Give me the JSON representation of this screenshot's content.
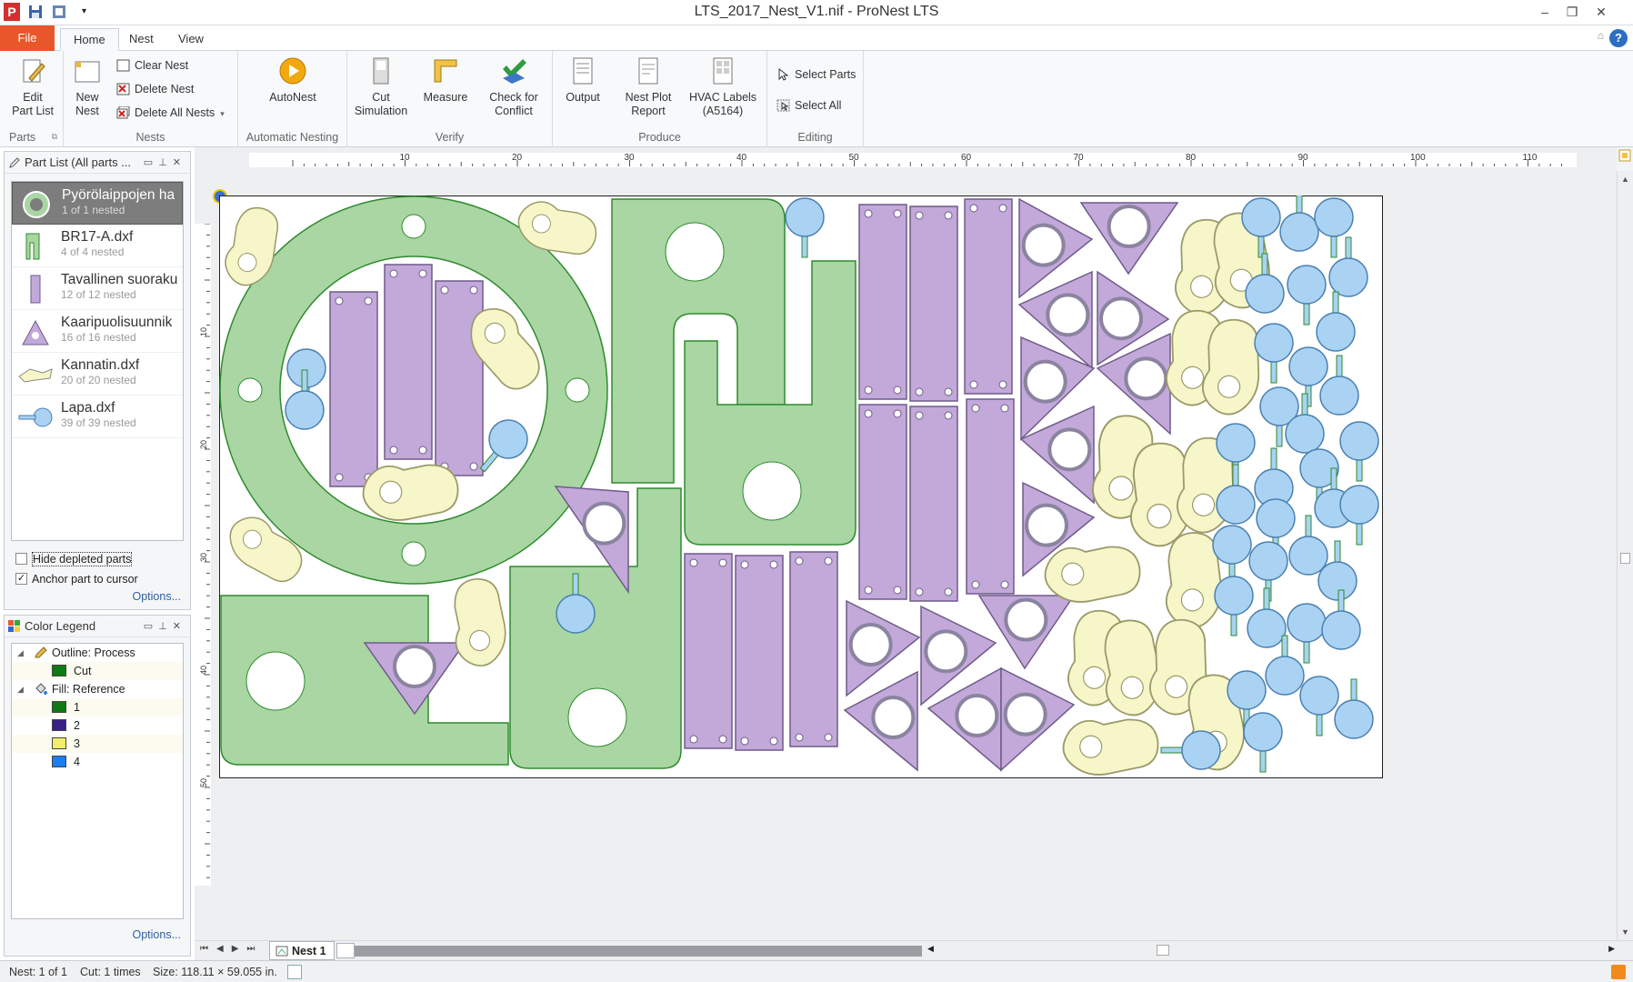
{
  "window": {
    "title": "LTS_2017_Nest_V1.nif - ProNest LTS",
    "logo_letter": "P"
  },
  "tabs": {
    "file": "File",
    "home": "Home",
    "nest": "Nest",
    "view": "View"
  },
  "help_glyph": "?",
  "ribbon": {
    "parts": {
      "edit_l1": "Edit",
      "edit_l2": "Part List",
      "label": "Parts"
    },
    "nests": {
      "new_l1": "New",
      "new_l2": "Nest",
      "clear": "Clear Nest",
      "delete": "Delete Nest",
      "delete_all": "Delete All Nests",
      "label": "Nests"
    },
    "automatic": {
      "autonest": "AutoNest",
      "label": "Automatic Nesting"
    },
    "verify": {
      "cut_l1": "Cut",
      "cut_l2": "Simulation",
      "measure": "Measure",
      "check_l1": "Check for",
      "check_l2": "Conflict",
      "label": "Verify"
    },
    "produce": {
      "output": "Output",
      "report_l1": "Nest Plot",
      "report_l2": "Report",
      "hvac_l1": "HVAC Labels",
      "hvac_l2": "(A5164)",
      "label": "Produce"
    },
    "editing": {
      "select_parts": "Select Parts",
      "select_all": "Select All",
      "label": "Editing"
    }
  },
  "part_list": {
    "title": "Part List  (All parts ...",
    "items": [
      {
        "name": "Pyörölaippojen ha",
        "count": "1 of 1 nested",
        "shape": "ring"
      },
      {
        "name": "BR17-A.dxf",
        "count": "4 of 4 nested",
        "shape": "bracket"
      },
      {
        "name": "Tavallinen suoraku",
        "count": "12 of 12 nested",
        "shape": "rect"
      },
      {
        "name": "Kaaripuolisuunnik",
        "count": "16 of 16 nested",
        "shape": "tri"
      },
      {
        "name": "Kannatin.dxf",
        "count": "20 of 20 nested",
        "shape": "hook"
      },
      {
        "name": "Lapa.dxf",
        "count": "39 of 39 nested",
        "shape": "paddle"
      }
    ],
    "hide_depleted": "Hide depleted parts",
    "anchor_cursor": "Anchor part to cursor",
    "options": "Options..."
  },
  "color_legend": {
    "title": "Color Legend",
    "outline": "Outline: Process",
    "cut": "Cut",
    "fill": "Fill: Reference",
    "fills": [
      {
        "label": "1",
        "color": "#0d7a13"
      },
      {
        "label": "2",
        "color": "#3a1f86"
      },
      {
        "label": "3",
        "color": "#f2ee6a"
      },
      {
        "label": "4",
        "color": "#1a7ff0"
      }
    ],
    "cut_color": "#0d7a13",
    "options": "Options..."
  },
  "ruler": {
    "h_labels": [
      "10",
      "20",
      "30",
      "40",
      "50",
      "60",
      "70",
      "80",
      "90",
      "100",
      "110"
    ],
    "v_labels": [
      "10",
      "20",
      "30",
      "40",
      "50"
    ]
  },
  "colors": {
    "ring_fill": "#a9d6a3",
    "rect_fill": "#c2a9d9",
    "hook_fill": "#f6f6c8",
    "paddle_fill": "#a9d2f3",
    "outline": "#2e8b2e"
  },
  "nav": {
    "nest_tab": "Nest 1"
  },
  "status": {
    "nest": "Nest: 1 of 1",
    "cut": "Cut: 1 times",
    "size": "Size: 118.11 × 59.055 in."
  }
}
